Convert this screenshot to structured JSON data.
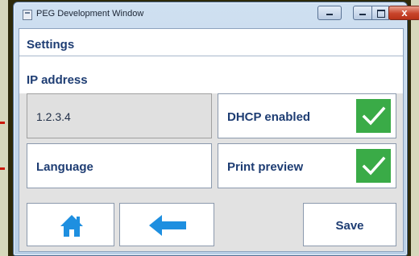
{
  "window": {
    "title": "PEG Development Window",
    "close_glyph": "x"
  },
  "settings": {
    "header": "Settings",
    "ip_label": "IP address",
    "ip_value": "1.2.3.4",
    "dhcp_label": "DHCP enabled",
    "dhcp_enabled": true,
    "language_label": "Language",
    "print_preview_label": "Print preview",
    "print_preview_enabled": true
  },
  "buttons": {
    "home_icon": "home-icon",
    "back_icon": "left-arrow-icon",
    "save_label": "Save"
  },
  "colors": {
    "accent_text": "#1e3d73",
    "check_green": "#3aab47",
    "icon_blue": "#1e8fe0"
  }
}
